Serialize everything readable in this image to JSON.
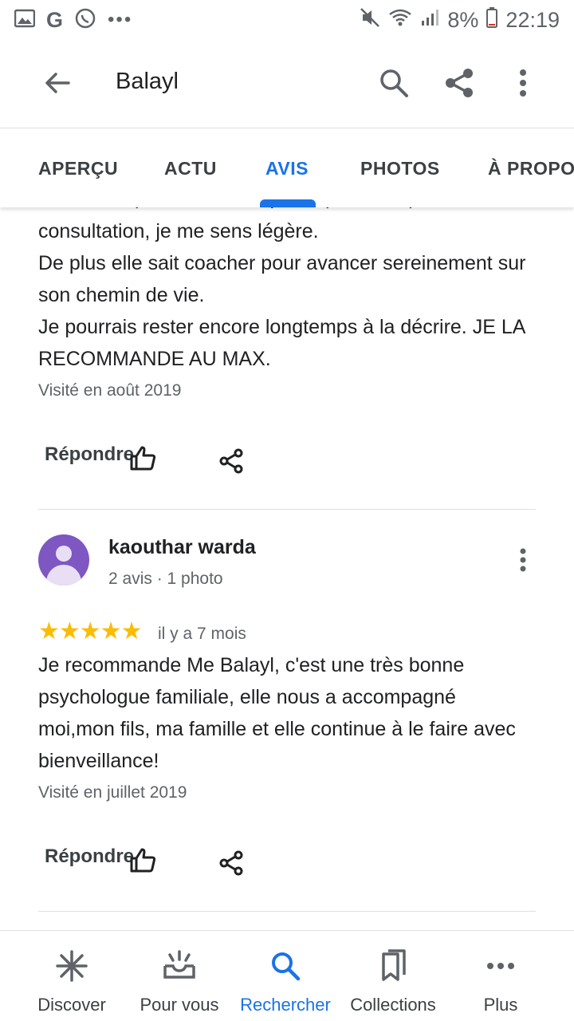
{
  "status_bar": {
    "g_letter": "G",
    "dots": "•••",
    "battery": "8%",
    "time": "22:19"
  },
  "app_bar": {
    "title": "Balayl"
  },
  "tabs": [
    {
      "label": "APERÇU"
    },
    {
      "label": "ACTU"
    },
    {
      "label": "AVIS"
    },
    {
      "label": "PHOTOS"
    },
    {
      "label": "À PROPOS"
    }
  ],
  "review1": {
    "partial_line": "nouvelles quand ca ne va pas. Apres chaque",
    "text": "consultation, je me sens légère.\nDe plus elle sait coacher pour avancer sereinement sur son chemin de vie.\nJe pourrais rester encore longtemps à la décrire. JE LA RECOMMANDE AU MAX.",
    "visited": "Visité en août 2019",
    "reply_label": "Répondre"
  },
  "review2": {
    "author": "kaouthar warda",
    "meta": "2 avis · 1 photo",
    "stars": "★★★★★",
    "date": "il y a 7 mois",
    "text": "Je recommande Me Balayl, c'est une très bonne psychologue familiale, elle nous a accompagné moi,mon fils, ma famille et elle continue à le faire avec bienveillance!",
    "visited": "Visité en juillet 2019",
    "reply_label": "Répondre"
  },
  "bottom_nav": [
    {
      "label": "Discover",
      "icon": "discover-icon"
    },
    {
      "label": "Pour vous",
      "icon": "for-you-icon"
    },
    {
      "label": "Rechercher",
      "icon": "search-icon"
    },
    {
      "label": "Collections",
      "icon": "collections-icon"
    },
    {
      "label": "Plus",
      "icon": "more-horiz-icon"
    }
  ],
  "colors": {
    "accent": "#1a73e8",
    "star": "#fbbc04",
    "avatar": "#7e57c2",
    "secondary_text": "#5f6368"
  }
}
